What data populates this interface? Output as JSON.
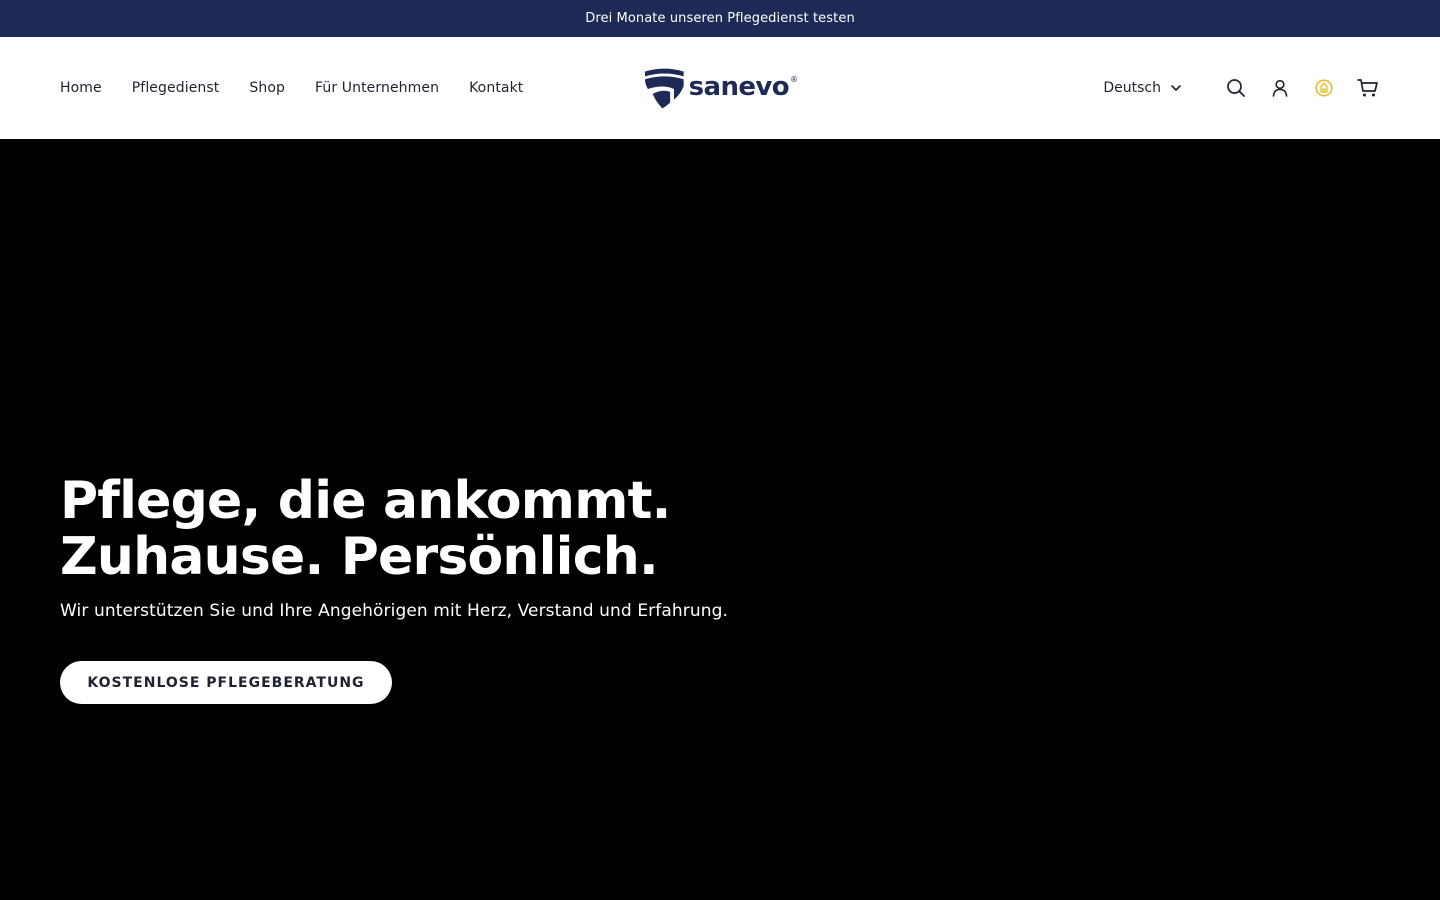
{
  "announcement": {
    "text": "Drei Monate unseren Pflegedienst testen"
  },
  "nav": {
    "items": [
      {
        "label": "Home"
      },
      {
        "label": "Pflegedienst"
      },
      {
        "label": "Shop"
      },
      {
        "label": "Für Unternehmen"
      },
      {
        "label": "Kontakt"
      }
    ]
  },
  "logo": {
    "text": "sanevo",
    "registered": "®"
  },
  "tools": {
    "language": "Deutsch",
    "icons": [
      "search-icon",
      "account-icon",
      "rewards-icon",
      "cart-icon"
    ]
  },
  "hero": {
    "title_line1": "Pflege, die ankommt.",
    "title_line2": "Zuhause. Persönlich.",
    "subtitle": "Wir unterstützen Sie und Ihre Angehörigen mit Herz, Verstand und Erfahrung.",
    "cta_label": "KOSTENLOSE PFLEGEBERATUNG"
  },
  "colors": {
    "brand_navy": "#1e2a55",
    "hero_background": "#000000",
    "header_background": "#ffffff",
    "rewards_accent": "#e8b923"
  }
}
